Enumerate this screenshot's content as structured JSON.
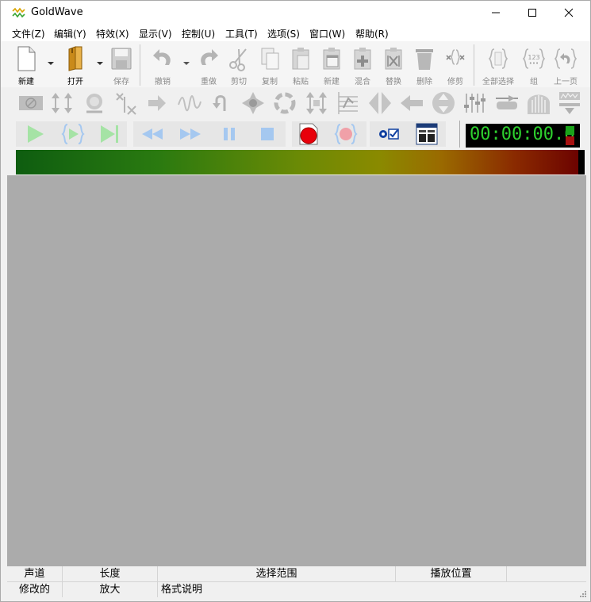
{
  "window": {
    "title": "GoldWave"
  },
  "menu": {
    "items": [
      "文件(Z)",
      "编辑(Y)",
      "特效(X)",
      "显示(V)",
      "控制(U)",
      "工具(T)",
      "选项(S)",
      "窗口(W)",
      "帮助(R)"
    ]
  },
  "toolbar": {
    "buttons": [
      {
        "label": "新建",
        "icon": "new-file-icon"
      },
      {
        "label": "打开",
        "icon": "open-folder-icon"
      },
      {
        "label": "保存",
        "icon": "save-disk-icon"
      },
      {
        "label": "撤销",
        "icon": "undo-icon"
      },
      {
        "label": "重做",
        "icon": "redo-icon"
      },
      {
        "label": "剪切",
        "icon": "scissors-icon"
      },
      {
        "label": "复制",
        "icon": "copy-icon"
      },
      {
        "label": "粘贴",
        "icon": "paste-icon"
      },
      {
        "label": "新建",
        "icon": "paste-new-icon"
      },
      {
        "label": "混合",
        "icon": "mix-icon"
      },
      {
        "label": "替换",
        "icon": "replace-icon"
      },
      {
        "label": "删除",
        "icon": "trash-icon"
      },
      {
        "label": "修剪",
        "icon": "trim-icon"
      },
      {
        "label": "全部选择",
        "icon": "select-all-icon"
      },
      {
        "label": "组",
        "icon": "group-icon"
      },
      {
        "label": "上一页",
        "icon": "previous-icon"
      }
    ]
  },
  "transport": {
    "time": "00:00:00.0"
  },
  "status": {
    "row1": [
      "声道",
      "长度",
      "选择范围",
      "播放位置"
    ],
    "row2": [
      "修改的",
      "放大",
      "格式说明"
    ]
  },
  "colors": {
    "work_area": "#ababab",
    "timer_text": "#2ed02e",
    "record": "#e8000a"
  }
}
